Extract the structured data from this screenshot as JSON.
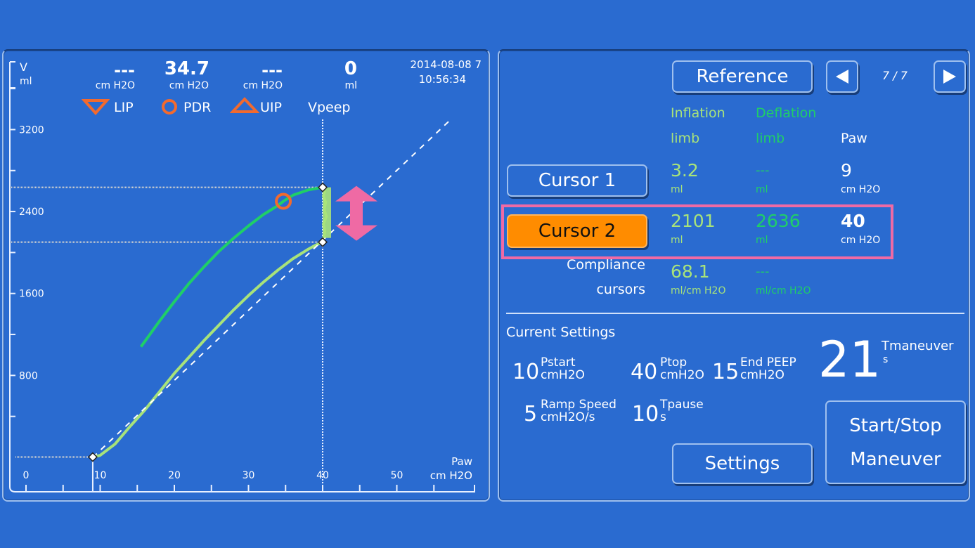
{
  "chart": {
    "header": {
      "lip": {
        "value": "---",
        "unit": "cm H2O",
        "label": "LIP"
      },
      "pdr": {
        "value": "34.7",
        "unit": "cm H2O",
        "label": "PDR"
      },
      "uip": {
        "value": "---",
        "unit": "cm H2O",
        "label": "UIP"
      },
      "vpeep": {
        "value": "0",
        "unit": "ml",
        "label": "Vpeep"
      },
      "date": "2014-08-08  7",
      "time": "10:56:34"
    },
    "marker_colors": {
      "lip": "#f26a2e",
      "pdr": "#f26a2e",
      "uip": "#f26a2e",
      "arrow": "#ef6aa4"
    },
    "y_axis": {
      "label": "V",
      "unit": "ml"
    },
    "x_axis": {
      "label": "Paw",
      "unit": "cm H2O"
    }
  },
  "chart_data": {
    "type": "line",
    "title": "",
    "xlabel": "Paw (cm H2O)",
    "ylabel": "V (ml)",
    "xlim": [
      0,
      60
    ],
    "ylim": [
      0,
      4000
    ],
    "x_ticks": [
      0,
      10,
      20,
      30,
      40,
      50
    ],
    "y_ticks": [
      800,
      1600,
      2400,
      3200
    ],
    "x_tick_labels": [
      "0",
      "10",
      "20",
      "30",
      "40",
      "50"
    ],
    "y_tick_labels": [
      "800",
      "1600",
      "2400",
      "3200"
    ],
    "series": [
      {
        "name": "Inflation limb",
        "color": "#a8e37a",
        "x": [
          9,
          10,
          12,
          14,
          16,
          18,
          20,
          22,
          24,
          26,
          28,
          30,
          32,
          34,
          36,
          38,
          39,
          40
        ],
        "y": [
          0,
          20,
          130,
          300,
          460,
          640,
          820,
          980,
          1140,
          1290,
          1440,
          1580,
          1710,
          1830,
          1940,
          2030,
          2070,
          2101
        ]
      },
      {
        "name": "Vpeep settling",
        "color": "#a8e37a",
        "x": [
          40,
          40.3,
          40.1,
          40.5,
          40.2,
          40.4,
          40.1,
          40.3,
          40
        ],
        "y": [
          2101,
          2200,
          2280,
          2350,
          2420,
          2490,
          2550,
          2610,
          2636
        ]
      },
      {
        "name": "Deflation limb",
        "color": "#1fcf67",
        "x": [
          15.5,
          18,
          20,
          22,
          24,
          26,
          28,
          30,
          32,
          34,
          34.7,
          36,
          38,
          40
        ],
        "y": [
          1080,
          1330,
          1520,
          1700,
          1860,
          2010,
          2140,
          2260,
          2370,
          2460,
          2500,
          2560,
          2610,
          2636
        ]
      },
      {
        "name": "Reference line",
        "style": "dashed",
        "color": "#ffffff",
        "x": [
          9,
          57
        ],
        "y": [
          0,
          3280
        ]
      }
    ],
    "cursors": [
      {
        "name": "Cursor 1",
        "paw": 9,
        "volume": 3.2
      },
      {
        "name": "Cursor 2",
        "paw": 40,
        "inflation_volume": 2101,
        "deflation_volume": 2636
      }
    ],
    "annotations": [
      {
        "type": "PDR marker",
        "x": 34.7,
        "y": 2500
      },
      {
        "type": "Vpeep vertical line",
        "x": 40
      },
      {
        "type": "double arrow",
        "from": 2101,
        "to": 2636
      }
    ],
    "grid": false,
    "legend": "top"
  },
  "right": {
    "reference_label": "Reference",
    "page_indicator": "7 / 7",
    "columns": {
      "inflation": [
        "Inflation",
        "limb"
      ],
      "deflation": [
        "Deflation",
        "limb"
      ],
      "paw": "Paw"
    },
    "cursor1": {
      "label": "Cursor 1",
      "inflation": "3.2",
      "inflation_unit": "ml",
      "deflation": "---",
      "deflation_unit": "ml",
      "paw": "9",
      "paw_unit": "cm H2O"
    },
    "cursor2": {
      "label": "Cursor 2",
      "inflation": "2101",
      "inflation_unit": "ml",
      "deflation": "2636",
      "deflation_unit": "ml",
      "paw": "40",
      "paw_unit": "cm H2O"
    },
    "compliance": {
      "label1": "Compliance",
      "label2": "cursors",
      "inflation": "68.1",
      "inflation_unit": "ml/cm H2O",
      "deflation": "---",
      "deflation_unit": "ml/cm H2O"
    },
    "settings": {
      "title": "Current Settings",
      "pstart": {
        "value": "10",
        "label": "Pstart",
        "unit": "cmH2O"
      },
      "ptop": {
        "value": "40",
        "label": "Ptop",
        "unit": "cmH2O"
      },
      "end_peep": {
        "value": "15",
        "label": "End PEEP",
        "unit": "cmH2O"
      },
      "ramp_speed": {
        "value": "5",
        "label": "Ramp Speed",
        "unit": "cmH2O/s"
      },
      "tpause": {
        "value": "10",
        "label": "Tpause",
        "unit": "s"
      },
      "tmaneuver": {
        "value": "21",
        "label": "Tmaneuver",
        "unit": "s"
      }
    },
    "settings_button": "Settings",
    "start_stop_line1": "Start/Stop",
    "start_stop_line2": "Maneuver",
    "colors": {
      "inflation": "#a8e37a",
      "deflation": "#1fcf67",
      "cursor_active_bg": "#ff8c00",
      "highlight_box": "#ef6aa4"
    }
  }
}
